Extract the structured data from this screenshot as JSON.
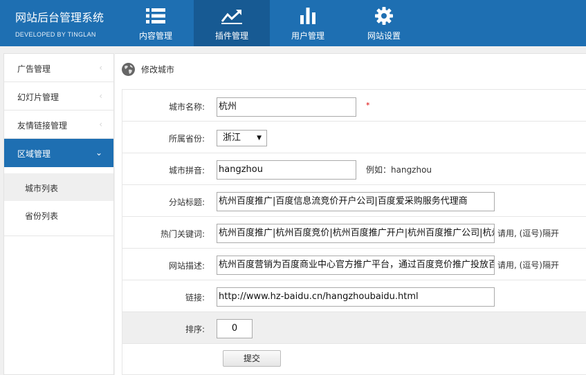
{
  "brand": {
    "title": "网站后台管理系统",
    "subtitle": "DEVELOPED BY TINGLAN"
  },
  "nav": [
    {
      "label": "内容管理",
      "icon": "list-icon",
      "active": false
    },
    {
      "label": "插件管理",
      "icon": "trending-up-icon",
      "active": true
    },
    {
      "label": "用户管理",
      "icon": "bar-chart-icon",
      "active": false
    },
    {
      "label": "网站设置",
      "icon": "gear-icon",
      "active": false
    }
  ],
  "sidebar": {
    "items": [
      {
        "label": "广告管理",
        "chevron": "‹"
      },
      {
        "label": "幻灯片管理",
        "chevron": "‹"
      },
      {
        "label": "友情链接管理",
        "chevron": "‹"
      },
      {
        "label": "区域管理",
        "chevron": "⌄"
      }
    ],
    "subitems": [
      {
        "label": "城市列表"
      },
      {
        "label": "省份列表"
      }
    ]
  },
  "page": {
    "title": "修改城市",
    "icon": "globe-icon"
  },
  "form": {
    "city_name": {
      "label": "城市名称:",
      "value": "杭州",
      "required_mark": "*"
    },
    "province": {
      "label": "所属省份:",
      "value": "浙江",
      "caret": "▼"
    },
    "pinyin": {
      "label": "城市拼音:",
      "value": "hangzhou",
      "hint": "例如：hangzhou"
    },
    "site_title": {
      "label": "分站标题:",
      "value": "杭州百度推广|百度信息流竞价开户公司|百度爱采购服务代理商"
    },
    "keywords": {
      "label": "热门关键词:",
      "value": "杭州百度推广|杭州百度竞价|杭州百度推广开户|杭州百度推广公司|杭州",
      "hint": "请用, (逗号)隔开"
    },
    "description": {
      "label": "网站描述:",
      "value": "杭州百度营销为百度商业中心官方推广平台，通过百度竞价推广投放百",
      "hint": "请用, (逗号)隔开"
    },
    "link": {
      "label": "链接:",
      "value": "http://www.hz-baidu.cn/hangzhoubaidu.html"
    },
    "sort": {
      "label": "排序:",
      "value": "0"
    },
    "submit_label": "提交"
  },
  "colors": {
    "brand_blue": "#1e6fb2",
    "nav_active": "#175a93",
    "required": "#dd0000"
  }
}
